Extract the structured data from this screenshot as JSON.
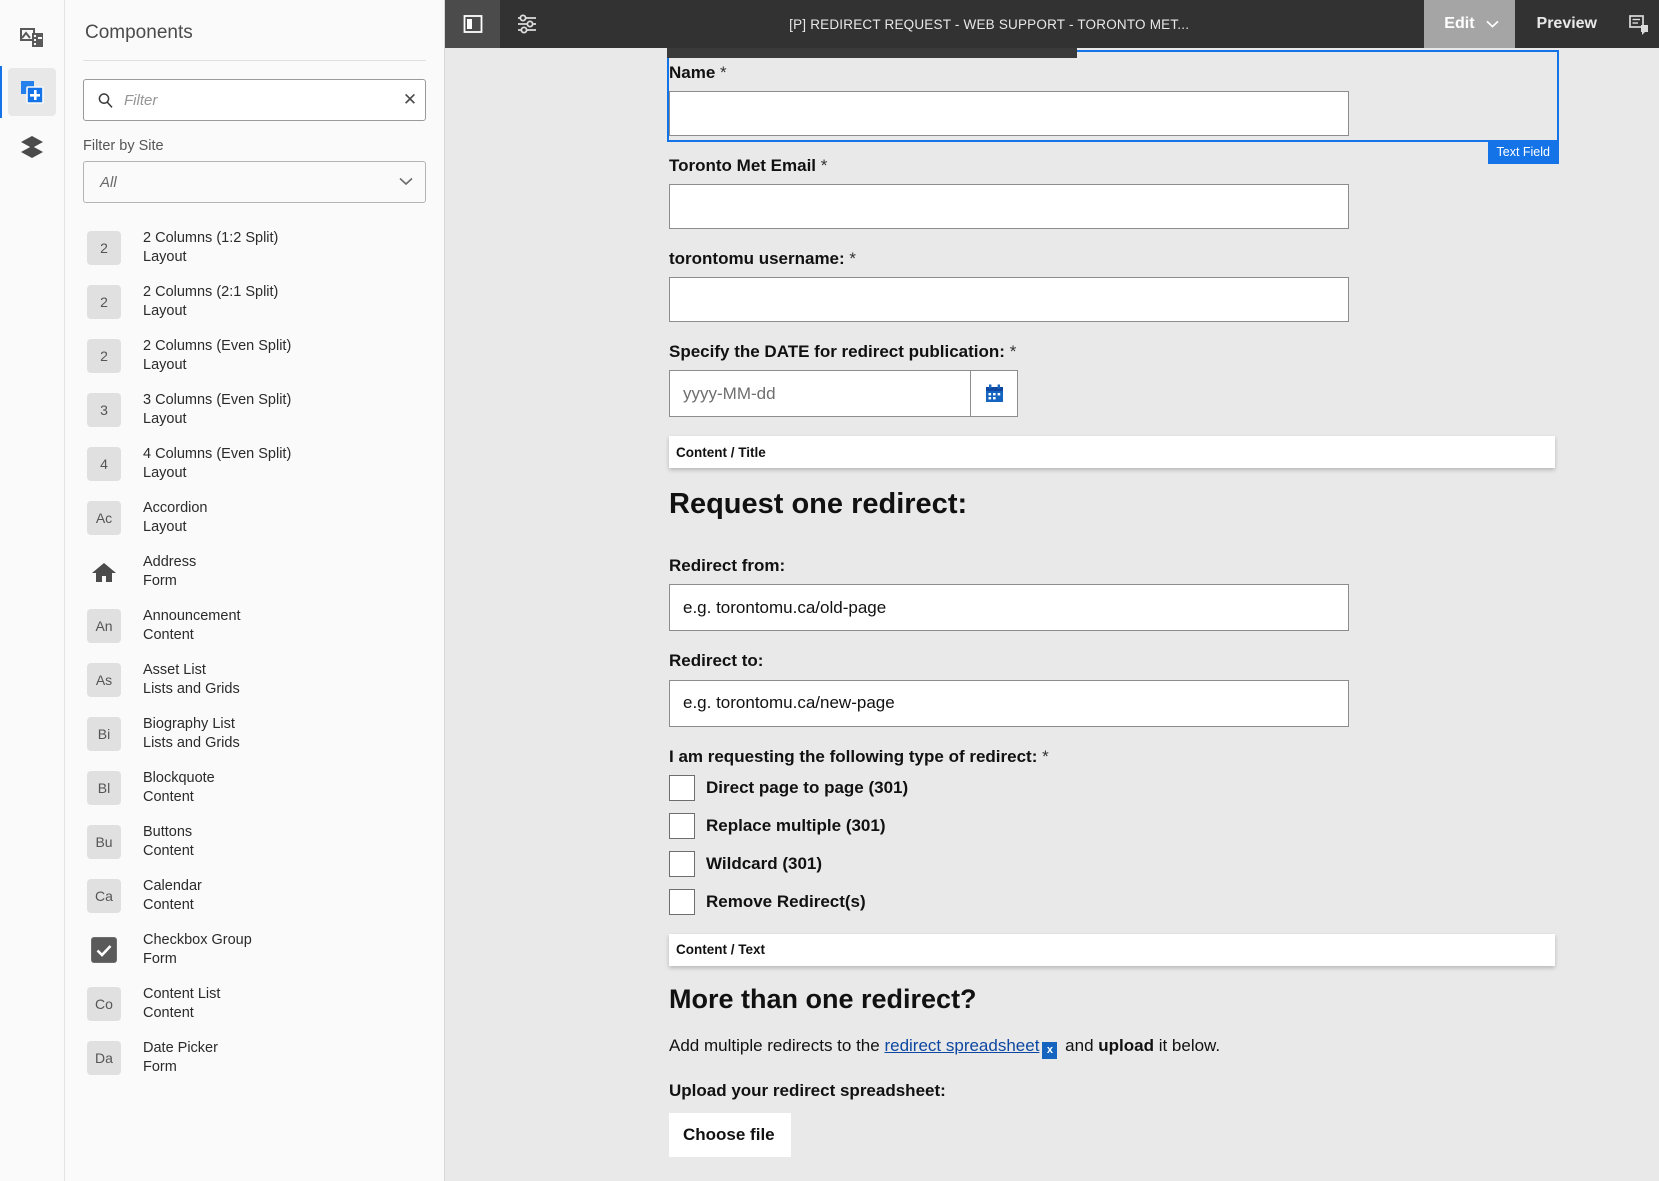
{
  "rail": {
    "items": [
      {
        "name": "assets-icon",
        "label": "Assets"
      },
      {
        "name": "components-icon",
        "label": "Components"
      },
      {
        "name": "layers-icon",
        "label": "Content Tree"
      }
    ]
  },
  "sidebar": {
    "title": "Components",
    "filter": {
      "placeholder": "Filter",
      "value": "",
      "clear_label": "✕"
    },
    "site_filter": {
      "label": "Filter by Site",
      "value": "All"
    },
    "components": [
      {
        "badge": "2",
        "name": "2 Columns (1:2 Split)",
        "group": "Layout"
      },
      {
        "badge": "2",
        "name": "2 Columns (2:1 Split)",
        "group": "Layout"
      },
      {
        "badge": "2",
        "name": "2 Columns (Even Split)",
        "group": "Layout"
      },
      {
        "badge": "3",
        "name": "3 Columns (Even Split)",
        "group": "Layout"
      },
      {
        "badge": "4",
        "name": "4 Columns (Even Split)",
        "group": "Layout"
      },
      {
        "badge": "Ac",
        "name": "Accordion",
        "group": "Layout"
      },
      {
        "badge": "",
        "name": "Address",
        "group": "Form",
        "icon": "home-icon"
      },
      {
        "badge": "An",
        "name": "Announcement",
        "group": "Content"
      },
      {
        "badge": "As",
        "name": "Asset List",
        "group": "Lists and Grids"
      },
      {
        "badge": "Bi",
        "name": "Biography List",
        "group": "Lists and Grids"
      },
      {
        "badge": "Bl",
        "name": "Blockquote",
        "group": "Content"
      },
      {
        "badge": "Bu",
        "name": "Buttons",
        "group": "Content"
      },
      {
        "badge": "Ca",
        "name": "Calendar",
        "group": "Content"
      },
      {
        "badge": "",
        "name": "Checkbox Group",
        "group": "Form",
        "icon": "checkbox-icon"
      },
      {
        "badge": "Co",
        "name": "Content List",
        "group": "Content"
      },
      {
        "badge": "Da",
        "name": "Date Picker",
        "group": "Form"
      }
    ]
  },
  "toolbar": {
    "page_title": "[P] REDIRECT REQUEST - WEB SUPPORT - TORONTO MET...",
    "sidepanel_icon": "side-panel-icon",
    "settings_icon": "page-properties-icon",
    "edit_label": "Edit",
    "preview_label": "Preview",
    "annotate_icon": "annotate-icon"
  },
  "selection": {
    "badge": "Text Field"
  },
  "form": {
    "name": {
      "label": "Name",
      "required": "*",
      "value": ""
    },
    "email": {
      "label": "Toronto Met Email",
      "required": "*",
      "value": ""
    },
    "username": {
      "label": "torontomu username:",
      "required": "*",
      "value": ""
    },
    "date": {
      "label": "Specify the DATE for redirect publication:",
      "required": "*",
      "placeholder": "yyyy-MM-dd",
      "calendar_icon": "calendar-icon"
    },
    "placeholder_title": "Content / Title",
    "section_one_heading": "Request one redirect:",
    "redirect_from": {
      "label": "Redirect from:",
      "value": "e.g. torontomu.ca/old-page"
    },
    "redirect_to": {
      "label": "Redirect to:",
      "value": "e.g. torontomu.ca/new-page"
    },
    "redirect_type": {
      "label": "I am requesting the following type of redirect:",
      "required": "*",
      "options": [
        {
          "label": "Direct page to page (301)",
          "checked": false
        },
        {
          "label": "Replace multiple (301)",
          "checked": false
        },
        {
          "label": "Wildcard (301)",
          "checked": false
        },
        {
          "label": "Remove Redirect(s)",
          "checked": false
        }
      ]
    },
    "placeholder_text": "Content / Text",
    "section_two_heading": "More than one redirect?",
    "paragraph": {
      "before": "Add multiple redirects to the ",
      "link": "redirect spreadsheet",
      "icon_char": "x",
      "middle": " and ",
      "bold": "upload",
      "after": " it below."
    },
    "upload": {
      "label": "Upload your redirect spreadsheet:",
      "button": "Choose file"
    }
  },
  "colors": {
    "accent": "#1473e6",
    "toolbar_bg": "#323232",
    "canvas_bg": "#e9e9e9",
    "link": "#0d47a1"
  }
}
